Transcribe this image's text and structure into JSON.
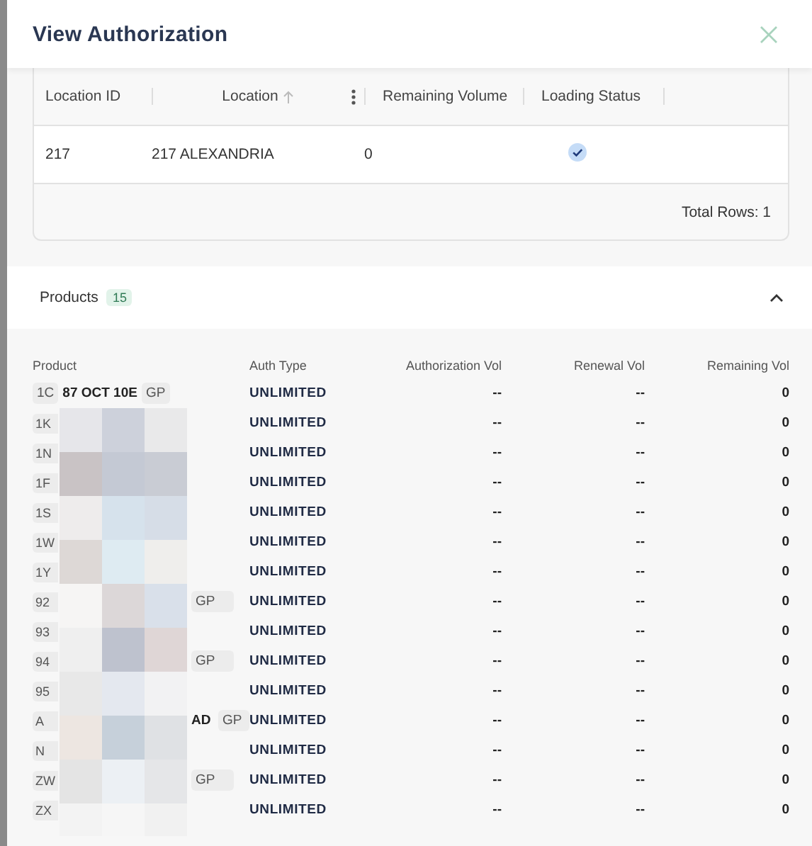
{
  "window": {
    "title": "View Authorization"
  },
  "locations": {
    "columns": [
      {
        "label": "Location ID"
      },
      {
        "label": "Location",
        "sorted": true,
        "menu": true
      },
      {
        "label": "Remaining Volume"
      },
      {
        "label": "Loading Status"
      }
    ],
    "rows": [
      {
        "id": "217",
        "location": "217 ALEXANDRIA",
        "remaining": "0",
        "loaded": true
      }
    ],
    "footer": "Total Rows: 1"
  },
  "products": {
    "title": "Products",
    "count": "15",
    "expanded": true,
    "columns": [
      "Product",
      "Auth Type",
      "Authorization Vol",
      "Renewal Vol",
      "Remaining Vol"
    ],
    "rows": [
      {
        "kind": "full",
        "code": "1C",
        "name": "87 OCT 10E",
        "tag": "GP",
        "auth": "UNLIMITED",
        "auth_vol": "--",
        "renewal_vol": "--",
        "remaining": "0"
      },
      {
        "kind": "masked",
        "code": "1K",
        "auth": "UNLIMITED",
        "auth_vol": "--",
        "renewal_vol": "--",
        "remaining": "0"
      },
      {
        "kind": "masked",
        "code": "1N",
        "auth": "UNLIMITED",
        "auth_vol": "--",
        "renewal_vol": "--",
        "remaining": "0"
      },
      {
        "kind": "masked",
        "code": "1F",
        "auth": "UNLIMITED",
        "auth_vol": "--",
        "renewal_vol": "--",
        "remaining": "0"
      },
      {
        "kind": "masked",
        "code": "1S",
        "auth": "UNLIMITED",
        "auth_vol": "--",
        "renewal_vol": "--",
        "remaining": "0"
      },
      {
        "kind": "masked",
        "code": "1W",
        "auth": "UNLIMITED",
        "auth_vol": "--",
        "renewal_vol": "--",
        "remaining": "0"
      },
      {
        "kind": "masked",
        "code": "1Y",
        "auth": "UNLIMITED",
        "auth_vol": "--",
        "renewal_vol": "--",
        "remaining": "0"
      },
      {
        "kind": "masked",
        "code": "92",
        "tag": "GP",
        "auth": "UNLIMITED",
        "auth_vol": "--",
        "renewal_vol": "--",
        "remaining": "0"
      },
      {
        "kind": "masked",
        "code": "93",
        "auth": "UNLIMITED",
        "auth_vol": "--",
        "renewal_vol": "--",
        "remaining": "0"
      },
      {
        "kind": "masked",
        "code": "94",
        "tag": "GP",
        "auth": "UNLIMITED",
        "auth_vol": "--",
        "renewal_vol": "--",
        "remaining": "0"
      },
      {
        "kind": "masked",
        "code": "95",
        "auth": "UNLIMITED",
        "auth_vol": "--",
        "renewal_vol": "--",
        "remaining": "0"
      },
      {
        "kind": "masked",
        "code": "A",
        "name": "AD",
        "tag": "GP",
        "auth": "UNLIMITED",
        "auth_vol": "--",
        "renewal_vol": "--",
        "remaining": "0"
      },
      {
        "kind": "masked",
        "code": "N",
        "auth": "UNLIMITED",
        "auth_vol": "--",
        "renewal_vol": "--",
        "remaining": "0"
      },
      {
        "kind": "masked",
        "code": "ZW",
        "tag": "GP",
        "auth": "UNLIMITED",
        "auth_vol": "--",
        "renewal_vol": "--",
        "remaining": "0"
      },
      {
        "kind": "masked",
        "code": "ZX",
        "auth": "UNLIMITED",
        "auth_vol": "--",
        "renewal_vol": "--",
        "remaining": "0"
      }
    ]
  }
}
